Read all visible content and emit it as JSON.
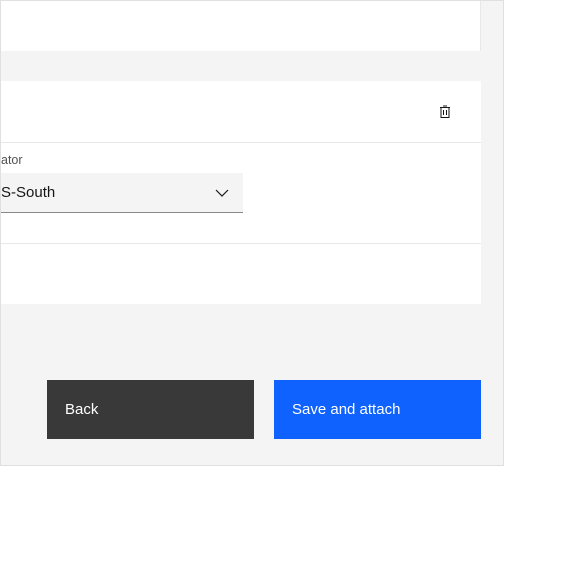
{
  "form": {
    "field_label_fragment": "ator",
    "dropdown_value": "S-South"
  },
  "buttons": {
    "back": "Back",
    "save": "Save and attach"
  },
  "icons": {
    "trash": "trash-icon",
    "chevron": "chevron-down-icon"
  }
}
